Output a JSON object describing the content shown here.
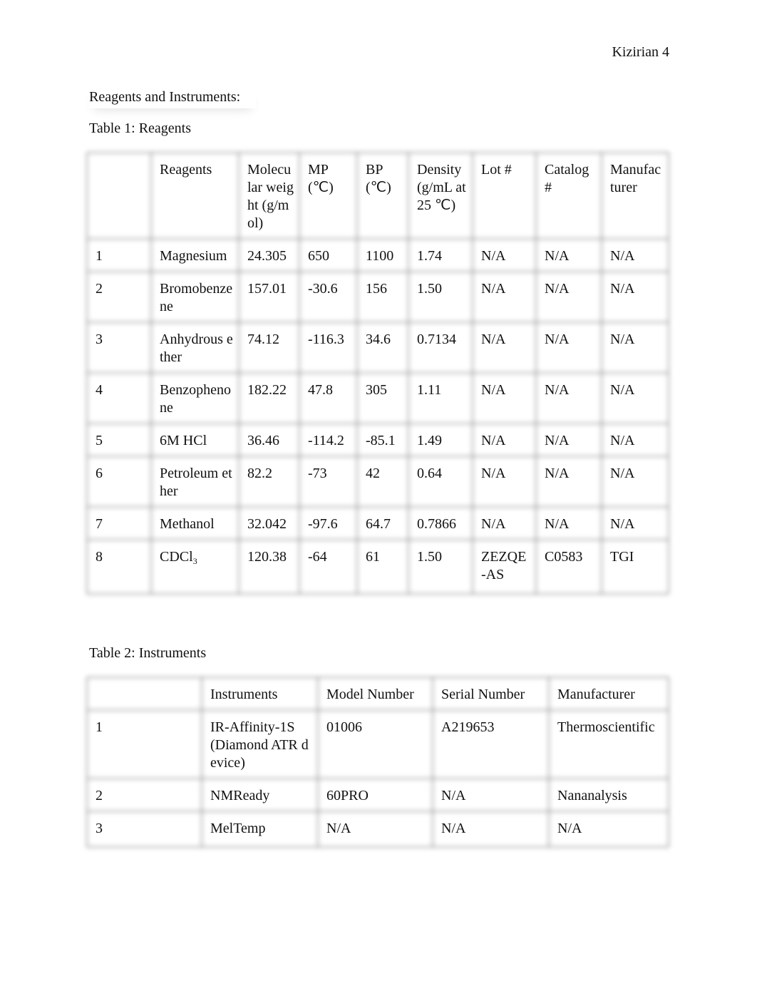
{
  "header": {
    "running_head": "Kizirian 4"
  },
  "section_heading": "Reagents and Instruments:",
  "table1": {
    "caption": "Table 1: Reagents",
    "columns": [
      "",
      "Reagents",
      "Molecular weight (g/mol)",
      "MP (℃)",
      "BP (℃)",
      "Density (g/mL at 25 ℃)",
      "Lot #",
      "Catalog #",
      "Manufacturer"
    ],
    "rows": [
      [
        "1",
        "Magnesium",
        "24.305",
        "650",
        "1100",
        "1.74",
        "N/A",
        "N/A",
        "N/A"
      ],
      [
        "2",
        "Bromobenzene",
        "157.01",
        "-30.6",
        "156",
        "1.50",
        "N/A",
        "N/A",
        "N/A"
      ],
      [
        "3",
        "Anhydrous ether",
        "74.12",
        "-116.3",
        "34.6",
        "0.7134",
        "N/A",
        "N/A",
        "N/A"
      ],
      [
        "4",
        "Benzophenone",
        "182.22",
        "47.8",
        "305",
        "1.11",
        "N/A",
        "N/A",
        "N/A"
      ],
      [
        "5",
        "6M HCl",
        "36.46",
        "-114.2",
        "-85.1",
        "1.49",
        "N/A",
        "N/A",
        "N/A"
      ],
      [
        "6",
        "Petroleum ether",
        "82.2",
        "-73",
        "42",
        "0.64",
        "N/A",
        "N/A",
        "N/A"
      ],
      [
        "7",
        "Methanol",
        "32.042",
        "-97.6",
        "64.7",
        "0.7866",
        "N/A",
        "N/A",
        "N/A"
      ],
      [
        "8",
        "CDCl",
        "120.38",
        "-64",
        "61",
        "1.50",
        "ZEZQE-AS",
        "C0583",
        "TGI"
      ]
    ],
    "cdcl_subscript": "3"
  },
  "table2": {
    "caption": "Table 2: Instruments",
    "columns": [
      "",
      "Instruments",
      "Model Number",
      "Serial Number",
      "Manufacturer"
    ],
    "rows": [
      [
        "1",
        "IR-Affinity-1S (Diamond ATR device)",
        "01006",
        "A219653",
        "Thermoscientific"
      ],
      [
        "2",
        "NMReady",
        "60PRO",
        "N/A",
        "Nananalysis"
      ],
      [
        "3",
        "MelTemp",
        "N/A",
        "N/A",
        "N/A"
      ]
    ]
  }
}
